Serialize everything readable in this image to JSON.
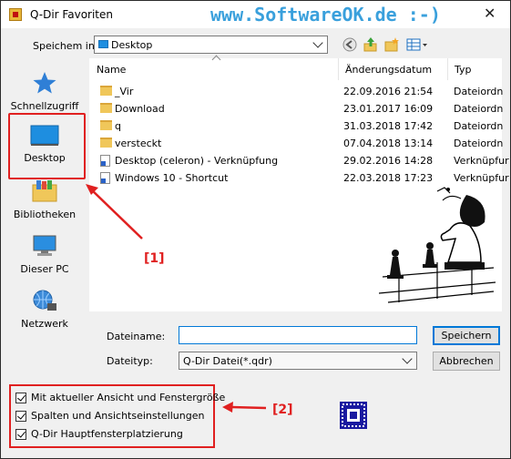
{
  "window": {
    "title": "Q-Dir Favoriten",
    "watermark": "www.SoftwareOK.de :-)"
  },
  "save_in": {
    "label": "Speichem in:",
    "value": "Desktop"
  },
  "toolbar": {
    "icons": [
      "back-icon",
      "up-folder-icon",
      "new-folder-icon",
      "view-menu-icon"
    ]
  },
  "sidebar": {
    "items": [
      {
        "label": "Schnellzugriff",
        "icon": "star-icon"
      },
      {
        "label": "Desktop",
        "icon": "desktop-icon"
      },
      {
        "label": "Bibliotheken",
        "icon": "library-icon"
      },
      {
        "label": "Dieser PC",
        "icon": "pc-icon"
      },
      {
        "label": "Netzwerk",
        "icon": "network-icon"
      }
    ]
  },
  "filelist": {
    "columns": [
      "Name",
      "Änderungsdatum",
      "Typ"
    ],
    "rows": [
      {
        "name": "_Vir",
        "date": "22.09.2016 21:54",
        "type": "Dateiordn",
        "icon": "folder-icon"
      },
      {
        "name": "Download",
        "date": "23.01.2017 16:09",
        "type": "Dateiordn",
        "icon": "folder-icon"
      },
      {
        "name": "q",
        "date": "31.03.2018 17:42",
        "type": "Dateiordn",
        "icon": "folder-icon"
      },
      {
        "name": "versteckt",
        "date": "07.04.2018 13:14",
        "type": "Dateiordn",
        "icon": "folder-icon"
      },
      {
        "name": "Desktop (celeron) - Verknüpfung",
        "date": "29.02.2016 14:28",
        "type": "Verknüpfur",
        "icon": "shortcut-icon"
      },
      {
        "name": "Windows 10 - Shortcut",
        "date": "22.03.2018 17:23",
        "type": "Verknüpfur",
        "icon": "shortcut-icon"
      }
    ]
  },
  "filename": {
    "label": "Dateiname:",
    "value": ""
  },
  "filetype": {
    "label": "Dateityp:",
    "value": "Q-Dir Datei(*.qdr)"
  },
  "buttons": {
    "save": "Speichern",
    "cancel": "Abbrechen"
  },
  "options": [
    {
      "label": "Mit aktueller Ansicht und Fenstergröße",
      "checked": true
    },
    {
      "label": "Spalten und Ansichtseinstellungen",
      "checked": true
    },
    {
      "label": "Q-Dir Hauptfensterplatzierung",
      "checked": true
    }
  ],
  "annotations": {
    "one": "[1]",
    "two": "[2]"
  },
  "colors": {
    "accent": "#0078d7",
    "highlight": "#e02020",
    "watermark": "#3aa0dc"
  }
}
